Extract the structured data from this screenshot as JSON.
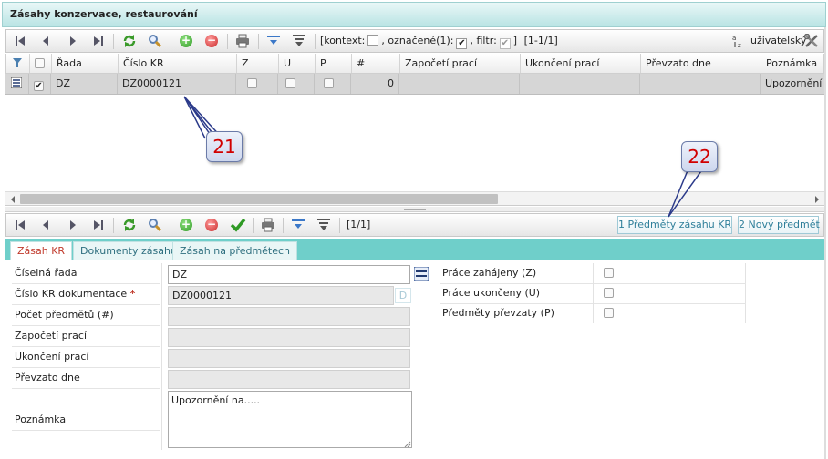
{
  "window": {
    "title": "Zásahy konzervace, restaurování"
  },
  "toolbar_top": {
    "kontext_label": "[kontext:",
    "oznacene_label": ", označené(1):",
    "filtr_label": ", filtr:",
    "filtr_end": "]",
    "range": "[1-1/1]",
    "user_label": "uživatelský"
  },
  "grid": {
    "columns": [
      "Řada",
      "Číslo KR",
      "Z",
      "U",
      "P",
      "#",
      "Započetí prací",
      "Ukončení prací",
      "Převzato dne",
      "Poznámka"
    ],
    "rows": [
      {
        "rada": "DZ",
        "cislo_kr": "DZ0000121",
        "count": "0",
        "poznamka": "Upozornění n"
      }
    ]
  },
  "callouts": {
    "c21": "21",
    "c22": "22"
  },
  "toolbar_bottom": {
    "range": "[1/1]",
    "btn_predmety": "1 Předměty zásahu KR",
    "btn_novy": "2 Nový předmět"
  },
  "tabs": [
    "Zásah KR",
    "Dokumenty zásahu",
    "Zásah na předmětech"
  ],
  "form": {
    "labels": {
      "rada": "Číselná řada",
      "cislo": "Číslo KR dokumentace",
      "pocet": "Počet předmětů (#)",
      "zapoceti": "Započetí prací",
      "ukonceni": "Ukončení prací",
      "prevzato": "Převzato dne",
      "poznamka": "Poznámka"
    },
    "required_mark": "*",
    "values": {
      "rada": "DZ",
      "cislo": "DZ0000121",
      "cislo_btn": "D",
      "poznamka": "Upozornění na....."
    },
    "right_labels": {
      "z": "Práce zahájeny (Z)",
      "u": "Práce ukončeny (U)",
      "p": "Předměty převzaty (P)"
    }
  },
  "colors": {
    "accent": "#6fcfca",
    "callout_text": "#d10000",
    "row_selected": "#d6d6d6"
  }
}
